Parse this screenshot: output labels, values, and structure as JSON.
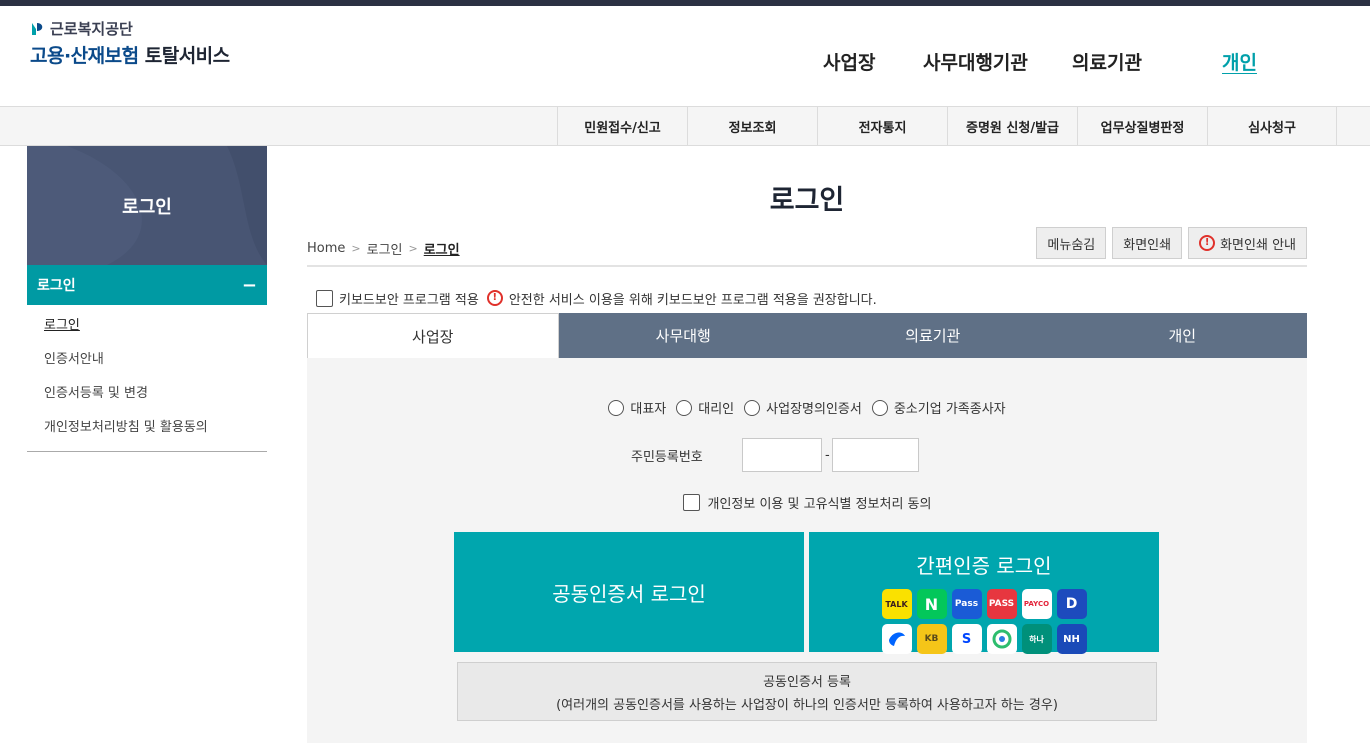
{
  "header": {
    "org_name": "근로복지공단",
    "site_title_blue": "고용·산재보험",
    "site_title_dark": "토탈서비스",
    "gnb": [
      "사업장",
      "사무대행기관",
      "의료기관",
      "개인"
    ],
    "gnb_active": "개인"
  },
  "subnav": [
    "민원접수/신고",
    "정보조회",
    "전자통지",
    "증명원 신청/발급",
    "업무상질병판정",
    "심사청구"
  ],
  "sidebar": {
    "title": "로그인",
    "section": "로그인",
    "section_toggle": "−",
    "items": [
      "로그인",
      "인증서안내",
      "인증서등록 및 변경",
      "개인정보처리방침 및 활용동의"
    ]
  },
  "main": {
    "page_title": "로그인",
    "breadcrumb": [
      "Home",
      "로그인",
      "로그인"
    ],
    "tools": {
      "hide_menu": "메뉴숨김",
      "print": "화면인쇄",
      "print_guide": "화면인쇄 안내"
    },
    "keyboard_security_label": "키보드보안 프로그램 적용",
    "keyboard_security_notice": "안전한 서비스 이용을 위해 키보드보안 프로그램 적용을 권장합니다.",
    "tabs": [
      "사업장",
      "사무대행",
      "의료기관",
      "개인"
    ],
    "active_tab": "사업장",
    "roles": [
      "대표자",
      "대리인",
      "사업장명의인증서",
      "중소기업 가족종사자"
    ],
    "ssn_label": "주민등록번호",
    "ssn_front": "",
    "ssn_back": "",
    "ssn_separator": "-",
    "agree_label": "개인정보 이용 및 고유식별 정보처리 동의",
    "cert_login": "공동인증서 로그인",
    "simple_login": "간편인증 로그인",
    "simple_auth_providers": [
      {
        "name": "kakao-talk-icon",
        "label": "TALK"
      },
      {
        "name": "naver-icon",
        "label": "N"
      },
      {
        "name": "samsung-pass-icon",
        "label": "Pass"
      },
      {
        "name": "pass-icon",
        "label": "PASS"
      },
      {
        "name": "payco-icon",
        "label": "PAYCO"
      },
      {
        "name": "dream-icon",
        "label": "D"
      },
      {
        "name": "toss-icon",
        "label": ""
      },
      {
        "name": "kb-icon",
        "label": "KB"
      },
      {
        "name": "shinhan-icon",
        "label": "S"
      },
      {
        "name": "woori-icon",
        "label": ""
      },
      {
        "name": "hana-icon",
        "label": "하나"
      },
      {
        "name": "nh-icon",
        "label": "NH"
      }
    ],
    "cert_register_title": "공동인증서 등록",
    "cert_register_desc": "(여러개의 공동인증서를 사용하는 사업장이 하나의 인증서만 등록하여 사용하고자 하는 경우)"
  },
  "colors": {
    "accent": "#00a6ae",
    "tab_bg": "#5f7086",
    "sidebar_head": "#485573",
    "warn": "#e0312b"
  }
}
